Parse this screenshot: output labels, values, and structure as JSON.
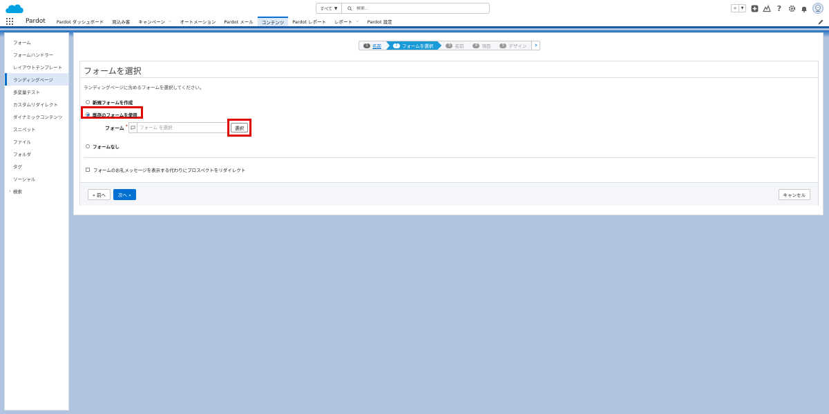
{
  "header": {
    "search_scope": "すべて",
    "search_placeholder": "検索..."
  },
  "nav": {
    "app_name": "Pardot",
    "items": [
      {
        "label": "Pardot ダッシュボード"
      },
      {
        "label": "見込み客"
      },
      {
        "label": "キャンペーン"
      },
      {
        "label": "オートメーション"
      },
      {
        "label": "Pardot メール"
      },
      {
        "label": "コンテンツ"
      },
      {
        "label": "Pardot レポート"
      },
      {
        "label": "レポート"
      },
      {
        "label": "Pardot 設定"
      }
    ]
  },
  "sidebar": {
    "items": [
      {
        "label": "フォーム"
      },
      {
        "label": "フォームハンドラー"
      },
      {
        "label": "レイアウトテンプレート"
      },
      {
        "label": "ランディングページ"
      },
      {
        "label": "多変量テスト"
      },
      {
        "label": "カスタムリダイレクト"
      },
      {
        "label": "ダイナミックコンテンツ"
      },
      {
        "label": "スニペット"
      },
      {
        "label": "ファイル"
      },
      {
        "label": "フォルダ"
      },
      {
        "label": "タグ"
      },
      {
        "label": "ソーシャル"
      },
      {
        "label": "検索"
      }
    ]
  },
  "wizard": {
    "steps": [
      {
        "num": "1",
        "label": "名前"
      },
      {
        "num": "2",
        "label": "フォームを選択"
      },
      {
        "num": "3",
        "label": "名前"
      },
      {
        "num": "4",
        "label": "項目"
      },
      {
        "num": "5",
        "label": "デザイン"
      }
    ]
  },
  "card": {
    "title": "フォームを選択",
    "intro": "ランディングページに含めるフォームを選択してください。",
    "option_new": "新規フォームを作成",
    "option_existing": "既存のフォームを使用",
    "form_label": "フォーム",
    "required_mark": "*",
    "form_placeholder": "フォーム を選択",
    "select_button": "選択",
    "option_none": "フォームなし",
    "redirect_checkbox": "フォームのお礼メッセージを表示する代わりにプロスペクトをリダイレクト"
  },
  "footer": {
    "prev": "« 前へ",
    "next": "次へ »",
    "cancel": "キャンセル"
  },
  "colors": {
    "brand_blue": "#0070d2",
    "highlight_red": "#e00000",
    "wizard_current": "#1a9bd7"
  }
}
